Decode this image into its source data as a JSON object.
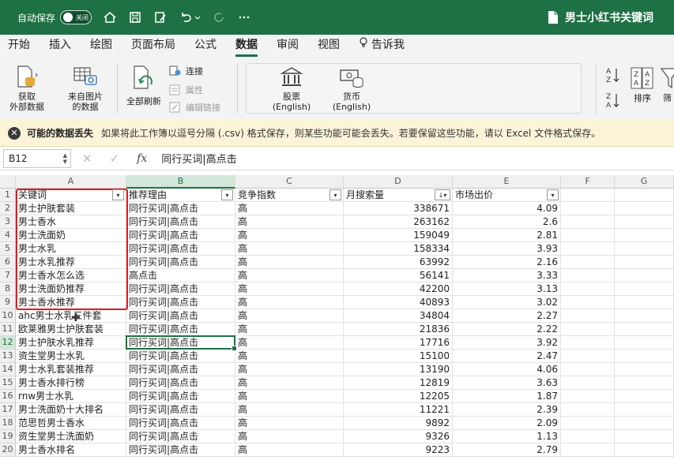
{
  "titlebar": {
    "autosave_label": "自动保存",
    "toggle_state": "关闭",
    "doc_title": "男士小红书关键词"
  },
  "menu": {
    "tabs": [
      "开始",
      "插入",
      "绘图",
      "页面布局",
      "公式",
      "数据",
      "审阅",
      "视图",
      "告诉我"
    ],
    "active": "数据"
  },
  "ribbon": {
    "get_external": "获取\n外部数据",
    "from_image": "来自图片\n的数据",
    "refresh_all": "全部刷新",
    "connections": "连接",
    "properties": "属性",
    "edit_links": "编辑链接",
    "stocks": "股票 (English)",
    "currency": "货币 (English)",
    "sort": "排序",
    "filter": "筛"
  },
  "infobar": {
    "title": "可能的数据丢失",
    "message": "如果将此工作簿以逗号分隔 (.csv) 格式保存，则某些功能可能会丢失。若要保留这些功能，请以 Excel 文件格式保存。"
  },
  "formula_bar": {
    "name_box": "B12",
    "fx": "fx",
    "value": "同行买词|高点击"
  },
  "grid": {
    "columns": [
      "A",
      "B",
      "C",
      "D",
      "E",
      "F",
      "G"
    ],
    "selected_column": "B",
    "selected_row": "12",
    "headers": [
      "关键词",
      "推荐理由",
      "竞争指数",
      "月搜索量",
      "市场出价"
    ],
    "rows": [
      [
        "男士护肤套装",
        "同行买词|高点击",
        "高",
        "338671",
        "4.09"
      ],
      [
        "男士香水",
        "同行买词|高点击",
        "高",
        "263162",
        "2.6"
      ],
      [
        "男士洗面奶",
        "同行买词|高点击",
        "高",
        "159049",
        "2.81"
      ],
      [
        "男士水乳",
        "同行买词|高点击",
        "高",
        "158334",
        "3.93"
      ],
      [
        "男士水乳推荐",
        "同行买词|高点击",
        "高",
        "63992",
        "2.16"
      ],
      [
        "男士香水怎么选",
        "高点击",
        "高",
        "56141",
        "3.33"
      ],
      [
        "男士洗面奶推荐",
        "同行买词|高点击",
        "高",
        "42200",
        "3.13"
      ],
      [
        "男士香水推荐",
        "同行买词|高点击",
        "高",
        "40893",
        "3.02"
      ],
      [
        "ahc男士水乳三件套",
        "同行买词|高点击",
        "高",
        "34804",
        "2.27"
      ],
      [
        "欧莱雅男士护肤套装",
        "同行买词|高点击",
        "高",
        "21836",
        "2.22"
      ],
      [
        "男士护肤水乳推荐",
        "同行买词|高点击",
        "高",
        "17716",
        "3.92"
      ],
      [
        "资生堂男士水乳",
        "同行买词|高点击",
        "高",
        "15100",
        "2.47"
      ],
      [
        "男士水乳套装推荐",
        "同行买词|高点击",
        "高",
        "13190",
        "4.06"
      ],
      [
        "男士香水排行榜",
        "同行买词|高点击",
        "高",
        "12819",
        "3.63"
      ],
      [
        "rnw男士水乳",
        "同行买词|高点击",
        "高",
        "12205",
        "1.87"
      ],
      [
        "男士洗面奶十大排名",
        "同行买词|高点击",
        "高",
        "11221",
        "2.39"
      ],
      [
        "范思哲男士香水",
        "同行买词|高点击",
        "高",
        "9892",
        "2.09"
      ],
      [
        "资生堂男士洗面奶",
        "同行买词|高点击",
        "高",
        "9326",
        "1.13"
      ],
      [
        "男士香水排名",
        "同行买词|高点击",
        "高",
        "9223",
        "2.79"
      ]
    ]
  },
  "colors": {
    "excel_green": "#1e7145",
    "highlight_red": "#e01b1b",
    "info_bg": "#fbf4d9"
  }
}
